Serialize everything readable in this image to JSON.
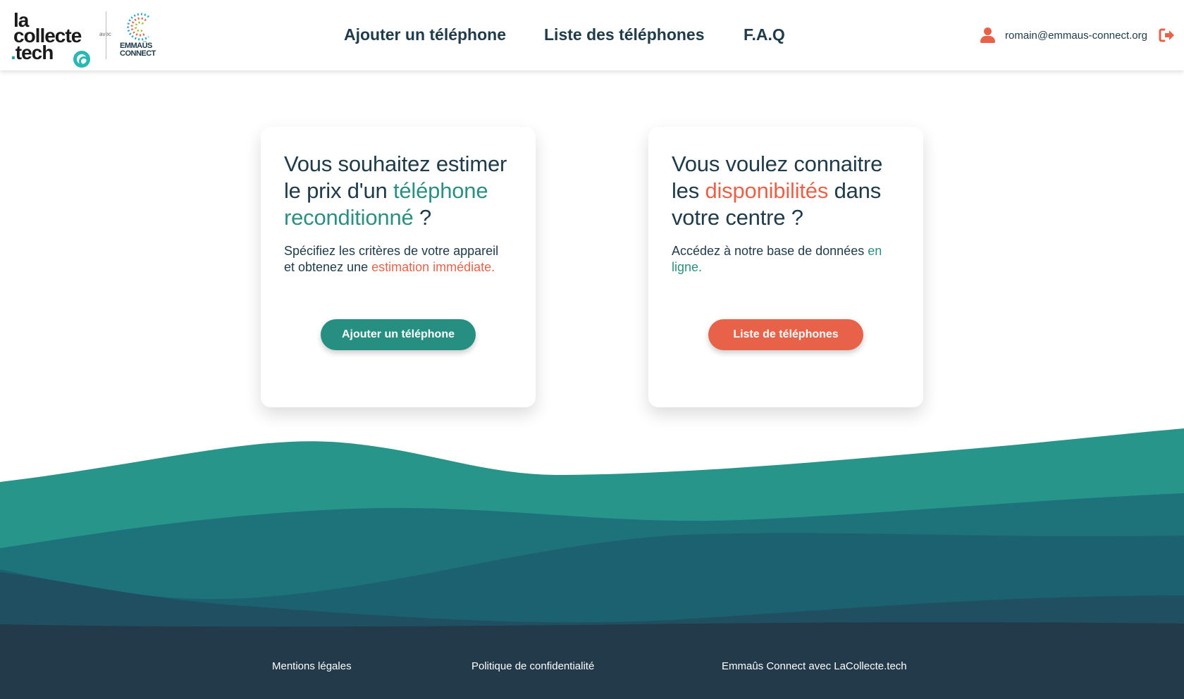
{
  "header": {
    "logo": {
      "line1": "la",
      "line2": "collecte",
      "line3_dot": ".",
      "line3": "tech",
      "avec": "avec",
      "partner_line1": "EMMAÜS",
      "partner_line2": "CONNECT"
    },
    "nav": [
      {
        "label": "Ajouter un téléphone"
      },
      {
        "label": "Liste des téléphones"
      },
      {
        "label": "F.A.Q"
      }
    ],
    "user": {
      "email": "romain@emmaus-connect.org",
      "icon": "user-icon",
      "logout_icon": "logout-icon"
    }
  },
  "cards": [
    {
      "title_part1": "Vous souhaitez estimer le prix d'un ",
      "title_highlight": "téléphone reconditionné",
      "title_part2": " ?",
      "text_part1": "Spécifiez les critères de votre appareil et obtenez une ",
      "text_highlight": "estimation immédiate.",
      "button": "Ajouter un téléphone"
    },
    {
      "title_part1": "Vous voulez connaitre les ",
      "title_highlight": "disponibilités",
      "title_part2": " dans votre centre ?",
      "text_part1": "Accédez à notre base de données ",
      "text_highlight": "en ligne.",
      "button": "Liste de téléphones"
    }
  ],
  "footer": {
    "links": [
      "Mentions légales",
      "Politique de confidentialité",
      "Emmaûs Connect avec LaCollecte.tech"
    ]
  },
  "colors": {
    "teal": "#2b8f81",
    "orange": "#e8624a",
    "navy": "#203b4a",
    "footer_bg": "#233a4a"
  }
}
